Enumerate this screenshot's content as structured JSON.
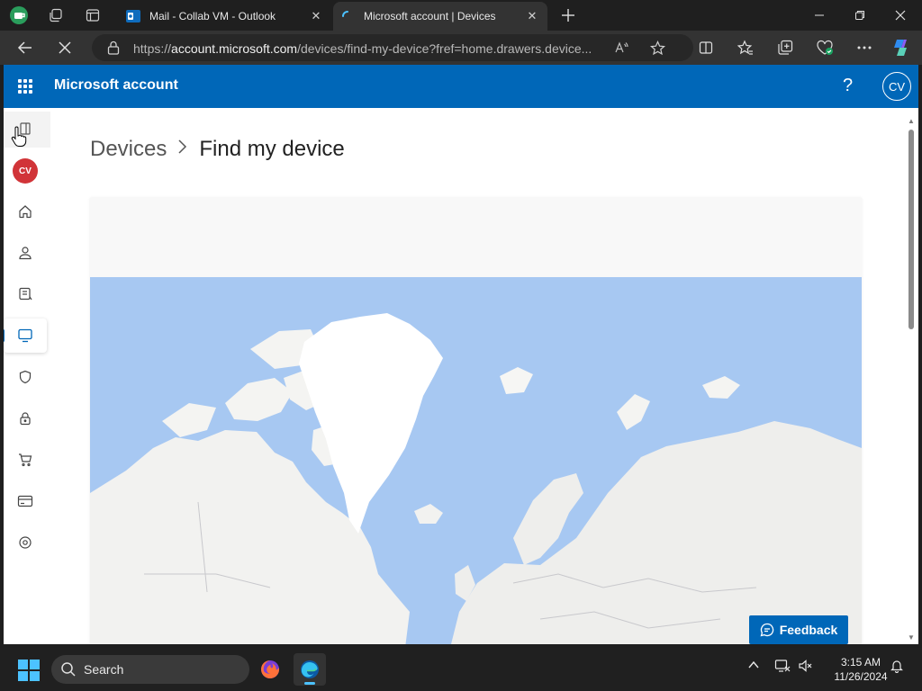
{
  "browser": {
    "tabs": [
      {
        "title": "Mail - Collab VM - Outlook",
        "active": false
      },
      {
        "title": "Microsoft account | Devices",
        "active": true
      }
    ],
    "address": {
      "domain": "account.microsoft.com",
      "url_prefix": "https://",
      "url_path": "/devices/find-my-device?fref=home.drawers.device..."
    }
  },
  "header": {
    "brand": "Microsoft account",
    "help_label": "?",
    "avatar_initials": "CV"
  },
  "sidebar": {
    "avatar_initials": "CV",
    "items": [
      {
        "icon": "home-icon"
      },
      {
        "icon": "person-icon"
      },
      {
        "icon": "info-card-icon"
      },
      {
        "icon": "devices-icon",
        "active": true
      },
      {
        "icon": "shield-icon"
      },
      {
        "icon": "lock-icon"
      },
      {
        "icon": "cart-icon"
      },
      {
        "icon": "payment-card-icon"
      },
      {
        "icon": "location-icon"
      }
    ]
  },
  "breadcrumb": {
    "parent": "Devices",
    "current": "Find my device"
  },
  "feedback_label": "Feedback",
  "taskbar": {
    "search_label": "Search",
    "time": "3:15 AM",
    "date": "11/26/2024"
  },
  "colors": {
    "brand_blue": "#0067b8",
    "map_water": "#a7c8f2",
    "avatar_red": "#d13438"
  }
}
